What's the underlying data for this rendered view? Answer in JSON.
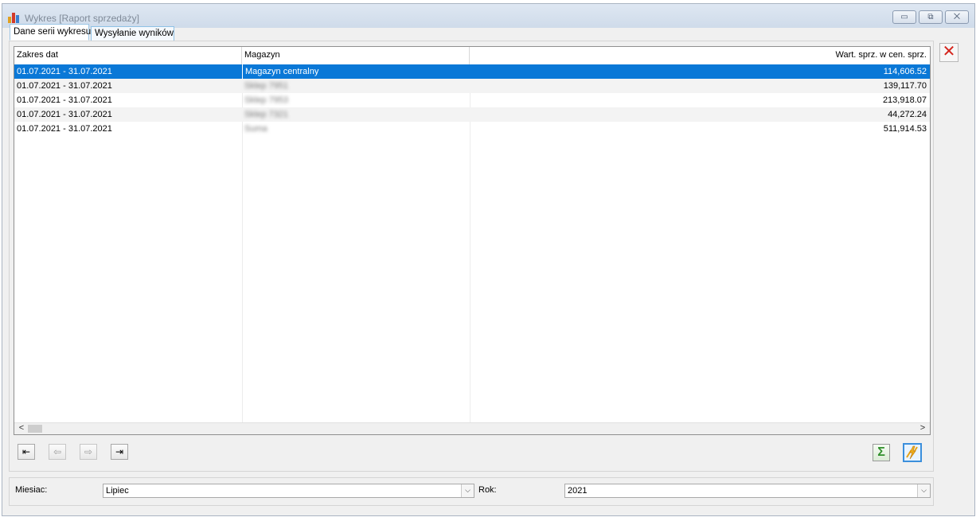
{
  "window": {
    "title": "Wykres [Raport sprzedaży]",
    "buttons": {
      "minimize": "▭",
      "restore": "⧉",
      "close": "⨉"
    }
  },
  "tabs": [
    {
      "label": "Dane serii wykresu",
      "active": true
    },
    {
      "label": "Wysyłanie wyników",
      "active": false
    }
  ],
  "grid": {
    "columns": [
      "Zakres dat",
      "Magazyn",
      "Wart. sprz. w cen. sprz."
    ],
    "rows": [
      {
        "date_range": "01.07.2021 - 31.07.2021",
        "warehouse": "Magazyn centralny",
        "value": "114,606.52",
        "selected": true
      },
      {
        "date_range": "01.07.2021 - 31.07.2021",
        "warehouse": "Sklep 7951",
        "value": "139,117.70"
      },
      {
        "date_range": "01.07.2021 - 31.07.2021",
        "warehouse": "Sklep 7953",
        "value": "213,918.07"
      },
      {
        "date_range": "01.07.2021 - 31.07.2021",
        "warehouse": "Sklep 7321",
        "value": "44,272.24"
      },
      {
        "date_range": "01.07.2021 - 31.07.2021",
        "warehouse": "Suma",
        "value": "511,914.53"
      }
    ],
    "scroll_left": "<",
    "scroll_right": ">"
  },
  "nav": {
    "first": "⇤",
    "prev": "⇦",
    "next": "⇨",
    "last": "⇥"
  },
  "actions": {
    "sum": "Σ"
  },
  "filters": {
    "month_label": "Miesiac:",
    "month_value": "Lipiec",
    "year_label": "Rok:",
    "year_value": "2021",
    "dropdown_glyph": "⌵"
  },
  "close_glyph": "✕"
}
